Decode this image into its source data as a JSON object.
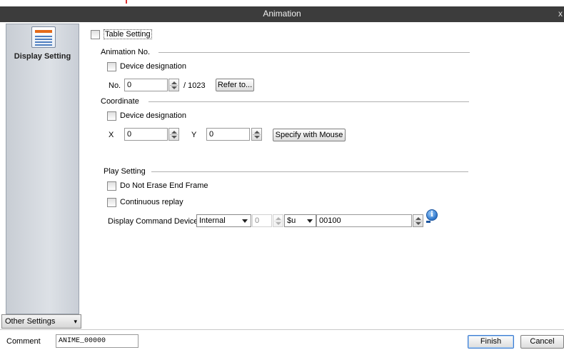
{
  "window": {
    "title": "Animation",
    "close_glyph": "x"
  },
  "sidebar": {
    "items": [
      {
        "label": "Display Setting",
        "icon": "display-setting-icon"
      }
    ],
    "other_settings": "Other Settings",
    "other_settings_arrow": "▾"
  },
  "table_setting": {
    "label": "Table Setting",
    "checked": false
  },
  "animation_no": {
    "group_label": "Animation No.",
    "device_designation": {
      "label": "Device designation",
      "checked": false
    },
    "no_label": "No.",
    "no_value": "0",
    "max_label": "/ 1023",
    "refer_button": "Refer to..."
  },
  "coordinate": {
    "group_label": "Coordinate",
    "device_designation": {
      "label": "Device designation",
      "checked": false
    },
    "x_label": "X",
    "x_value": "0",
    "y_label": "Y",
    "y_value": "0",
    "mouse_button": "Specify with Mouse"
  },
  "play_setting": {
    "group_label": "Play Setting",
    "do_not_erase": {
      "label": "Do Not Erase End Frame",
      "checked": false
    },
    "continuous": {
      "label": "Continuous replay",
      "checked": false
    },
    "display_command": {
      "label": "Display Command Device",
      "device_type": "Internal",
      "station_no": "0",
      "device_kind": "$u",
      "address": "00100"
    },
    "info_glyph": "i"
  },
  "footer": {
    "comment_label": "Comment",
    "comment_value": "ANIME_00000",
    "finish": "Finish",
    "cancel": "Cancel"
  },
  "colors": {
    "titlebar": "#3c3c3c",
    "sidebar": "#d0d5db",
    "accent_blue": "#2a73c8",
    "icon_header": "#e46a1a"
  }
}
